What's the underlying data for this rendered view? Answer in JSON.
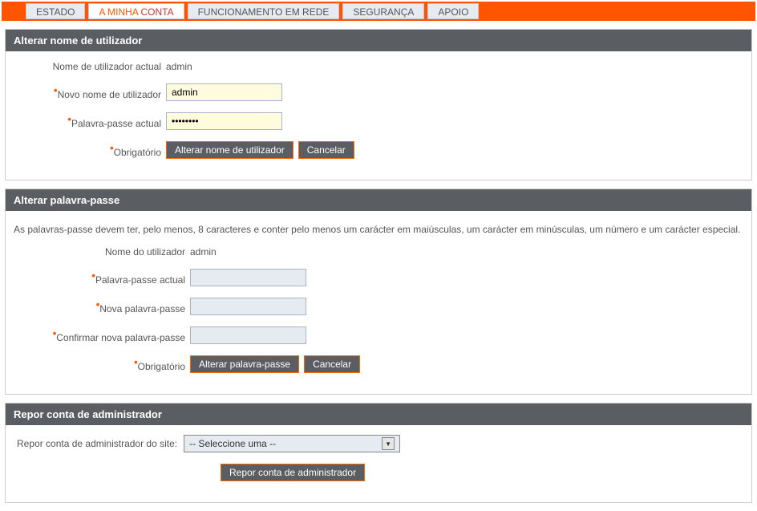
{
  "nav": {
    "tabs": [
      {
        "label": "ESTADO"
      },
      {
        "label_first": "A MINHA ",
        "label_second": "CONTA"
      },
      {
        "label": "FUNCIONAMENTO EM REDE"
      },
      {
        "label": "SEGURANÇA"
      },
      {
        "label": "APOIO"
      }
    ]
  },
  "section1": {
    "header": "Alterar nome de utilizador",
    "current_user_label": "Nome de utilizador actual",
    "current_user_value": "admin",
    "new_user_label": "Novo nome de utilizador",
    "new_user_value": "admin",
    "current_pass_label": "Palavra-passe actual",
    "current_pass_value": "••••••••",
    "required_label": "Obrigatório",
    "submit_btn": "Alterar nome de utilizador",
    "cancel_btn": "Cancelar"
  },
  "section2": {
    "header": "Alterar palavra-passe",
    "info": "As palavras-passe devem ter, pelo menos, 8 caracteres e conter pelo menos um carácter em maiúsculas, um carácter em minúsculas, um número e um carácter especial.",
    "user_label": "Nome do utilizador",
    "user_value": "admin",
    "current_pass_label": "Palavra-passe actual",
    "new_pass_label": "Nova palavra-passe",
    "confirm_pass_label": "Confirmar nova palavra-passe",
    "required_label": "Obrigatório",
    "submit_btn": "Alterar palavra-passe",
    "cancel_btn": "Cancelar"
  },
  "section3": {
    "header": "Repor conta de administrador",
    "label": "Repor conta de administrador do site:",
    "select_placeholder": "-- Seleccione uma --",
    "submit_btn": "Repor conta de administrador"
  }
}
